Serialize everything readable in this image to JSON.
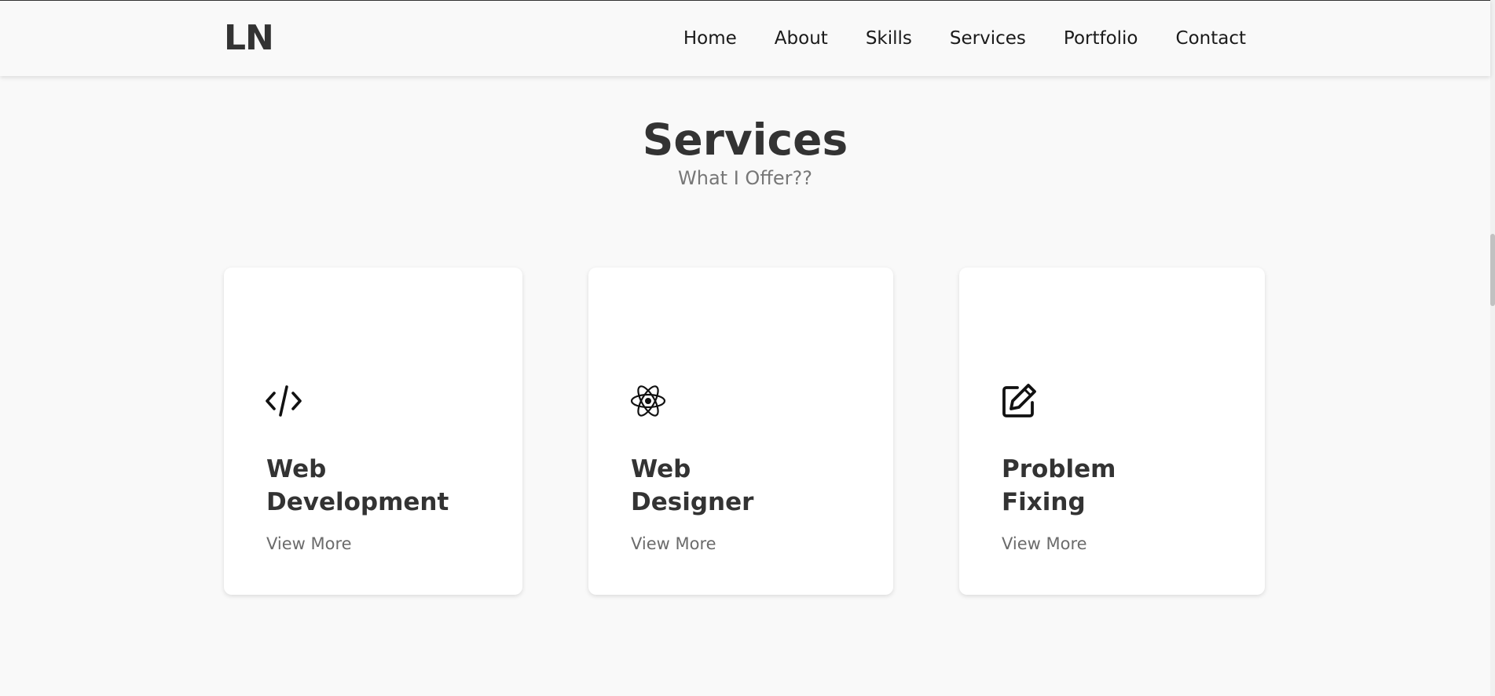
{
  "header": {
    "logo": "LN",
    "nav": [
      {
        "label": "Home"
      },
      {
        "label": "About"
      },
      {
        "label": "Skills"
      },
      {
        "label": "Services"
      },
      {
        "label": "Portfolio"
      },
      {
        "label": "Contact"
      }
    ]
  },
  "services": {
    "title": "Services",
    "subtitle": "What I Offer??",
    "cards": [
      {
        "icon": "code-icon",
        "title_line1": "Web",
        "title_line2": "Development",
        "link": "View More"
      },
      {
        "icon": "atom-icon",
        "title_line1": "Web",
        "title_line2": "Designer",
        "link": "View More"
      },
      {
        "icon": "edit-icon",
        "title_line1": "Problem",
        "title_line2": "Fixing",
        "link": "View More"
      }
    ]
  },
  "colors": {
    "background": "#f9f9f9",
    "card": "#ffffff",
    "text": "#333333",
    "muted": "#777777"
  }
}
